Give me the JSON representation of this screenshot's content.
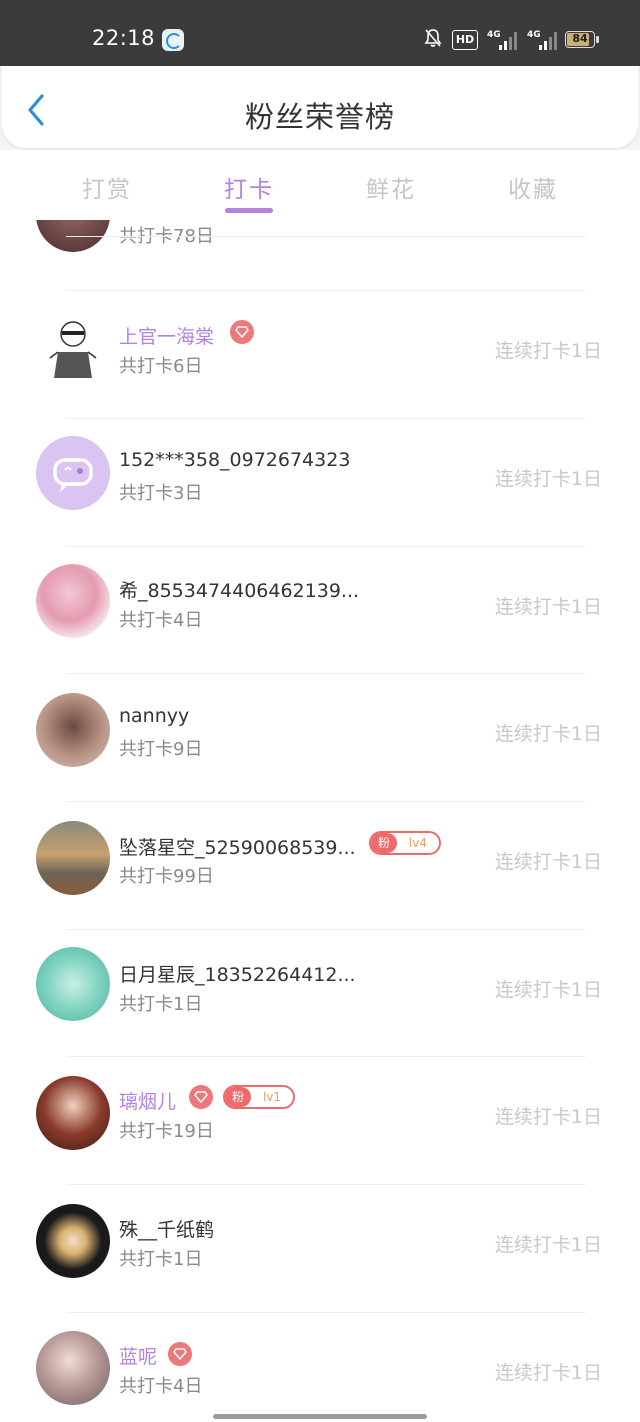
{
  "status_bar": {
    "time": "22:18",
    "hd_label": "HD",
    "network_1": "4G",
    "network_2": "4G",
    "battery": "84",
    "battery_percent": 84
  },
  "header": {
    "title": "粉丝荣誉榜",
    "back_icon": "chevron-left-icon"
  },
  "tabs": [
    {
      "label": "打赏",
      "active": false
    },
    {
      "label": "打卡",
      "active": true
    },
    {
      "label": "鲜花",
      "active": false
    },
    {
      "label": "收藏",
      "active": false
    }
  ],
  "colors": {
    "accent": "#b583dd",
    "gem": "#ee7777",
    "fan_badge": "#ef6a6a"
  },
  "fan_label": "粉",
  "partial_row": {
    "total": "共打卡78日"
  },
  "users": [
    {
      "name": "上官一海棠",
      "total": "共打卡6日",
      "streak": "连续打卡1日",
      "vip": true,
      "gem": true,
      "fan_level": ""
    },
    {
      "name": "152***358_0972674323",
      "total": "共打卡3日",
      "streak": "连续打卡1日",
      "vip": false,
      "gem": false,
      "fan_level": ""
    },
    {
      "name": "希_8553474406462139...",
      "total": "共打卡4日",
      "streak": "连续打卡1日",
      "vip": false,
      "gem": false,
      "fan_level": ""
    },
    {
      "name": "nannyy",
      "total": "共打卡9日",
      "streak": "连续打卡1日",
      "vip": false,
      "gem": false,
      "fan_level": ""
    },
    {
      "name": "坠落星空_52590068539...",
      "total": "共打卡99日",
      "streak": "连续打卡1日",
      "vip": false,
      "gem": false,
      "fan_level": "lv4"
    },
    {
      "name": "日月星辰_18352264412...",
      "total": "共打卡1日",
      "streak": "连续打卡1日",
      "vip": false,
      "gem": false,
      "fan_level": ""
    },
    {
      "name": "璃烟儿",
      "total": "共打卡19日",
      "streak": "连续打卡1日",
      "vip": true,
      "gem": true,
      "fan_level": "lv1"
    },
    {
      "name": "殊__千纸鹤",
      "total": "共打卡1日",
      "streak": "连续打卡1日",
      "vip": false,
      "gem": false,
      "fan_level": ""
    },
    {
      "name": "蓝呢",
      "total": "共打卡4日",
      "streak": "连续打卡1日",
      "vip": true,
      "gem": true,
      "fan_level": ""
    }
  ]
}
